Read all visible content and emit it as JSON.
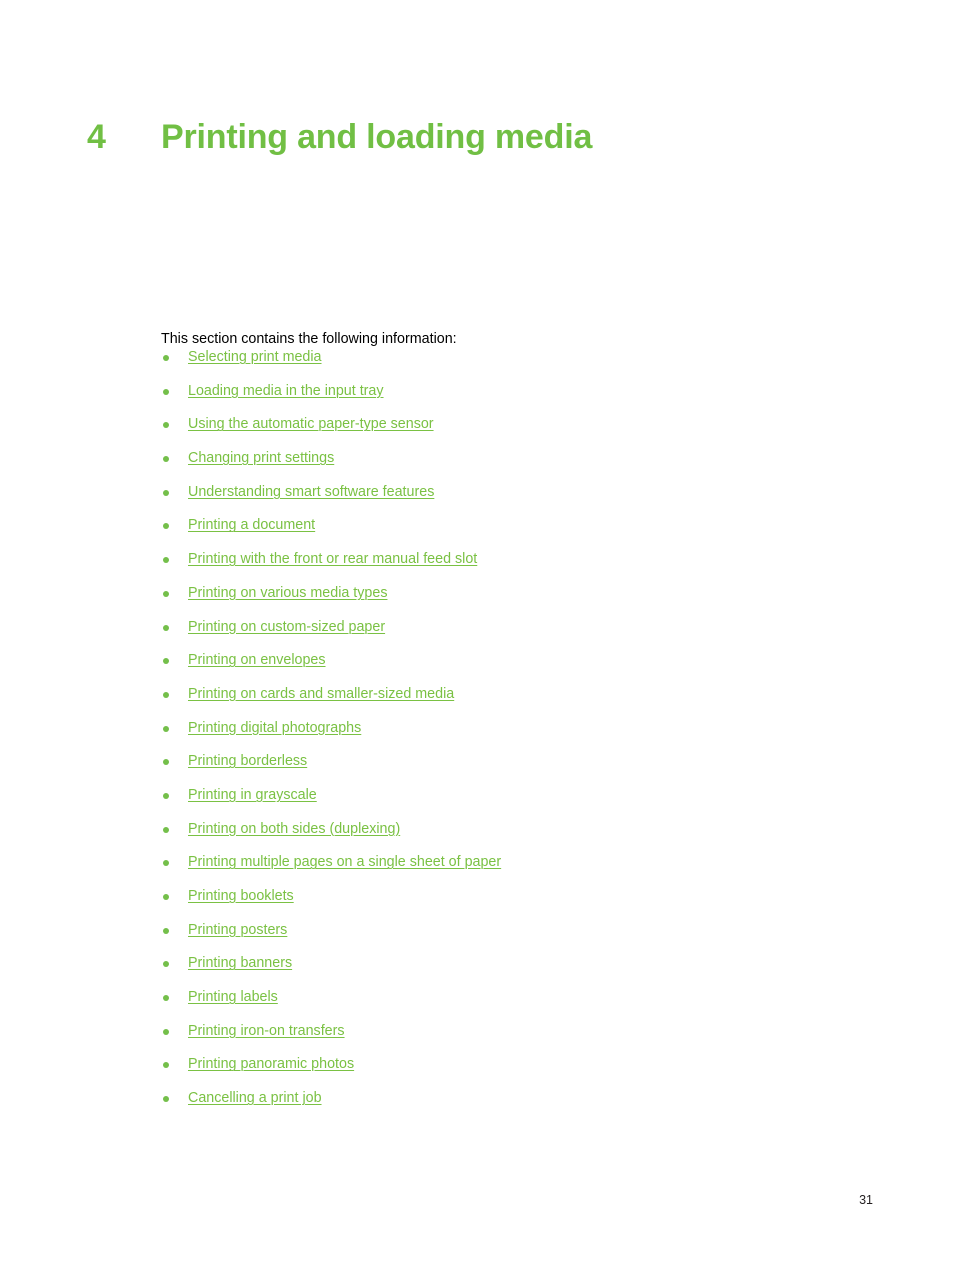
{
  "document": {
    "background_color": "#ffffff",
    "accent_color": "#71bf44",
    "link_color": "#7ac143",
    "body_text_color": "#000000"
  },
  "heading": {
    "number": "4",
    "title": "Printing and loading media"
  },
  "intro": {
    "text": "This section contains the following information:"
  },
  "toc": {
    "items": [
      {
        "label": "Selecting print media"
      },
      {
        "label": "Loading media in the input tray"
      },
      {
        "label": "Using the automatic paper-type sensor"
      },
      {
        "label": "Changing print settings"
      },
      {
        "label": "Understanding smart software features"
      },
      {
        "label": "Printing a document"
      },
      {
        "label": "Printing with the front or rear manual feed slot"
      },
      {
        "label": "Printing on various media types"
      },
      {
        "label": "Printing on custom-sized paper"
      },
      {
        "label": "Printing on envelopes"
      },
      {
        "label": "Printing on cards and smaller-sized media"
      },
      {
        "label": "Printing digital photographs"
      },
      {
        "label": "Printing borderless"
      },
      {
        "label": "Printing in grayscale"
      },
      {
        "label": "Printing on both sides (duplexing)"
      },
      {
        "label": "Printing multiple pages on a single sheet of paper"
      },
      {
        "label": "Printing booklets"
      },
      {
        "label": "Printing posters"
      },
      {
        "label": "Printing banners"
      },
      {
        "label": "Printing labels"
      },
      {
        "label": "Printing iron-on transfers"
      },
      {
        "label": "Printing panoramic photos"
      },
      {
        "label": "Cancelling a print job"
      }
    ]
  },
  "footer": {
    "page_number": "31"
  }
}
